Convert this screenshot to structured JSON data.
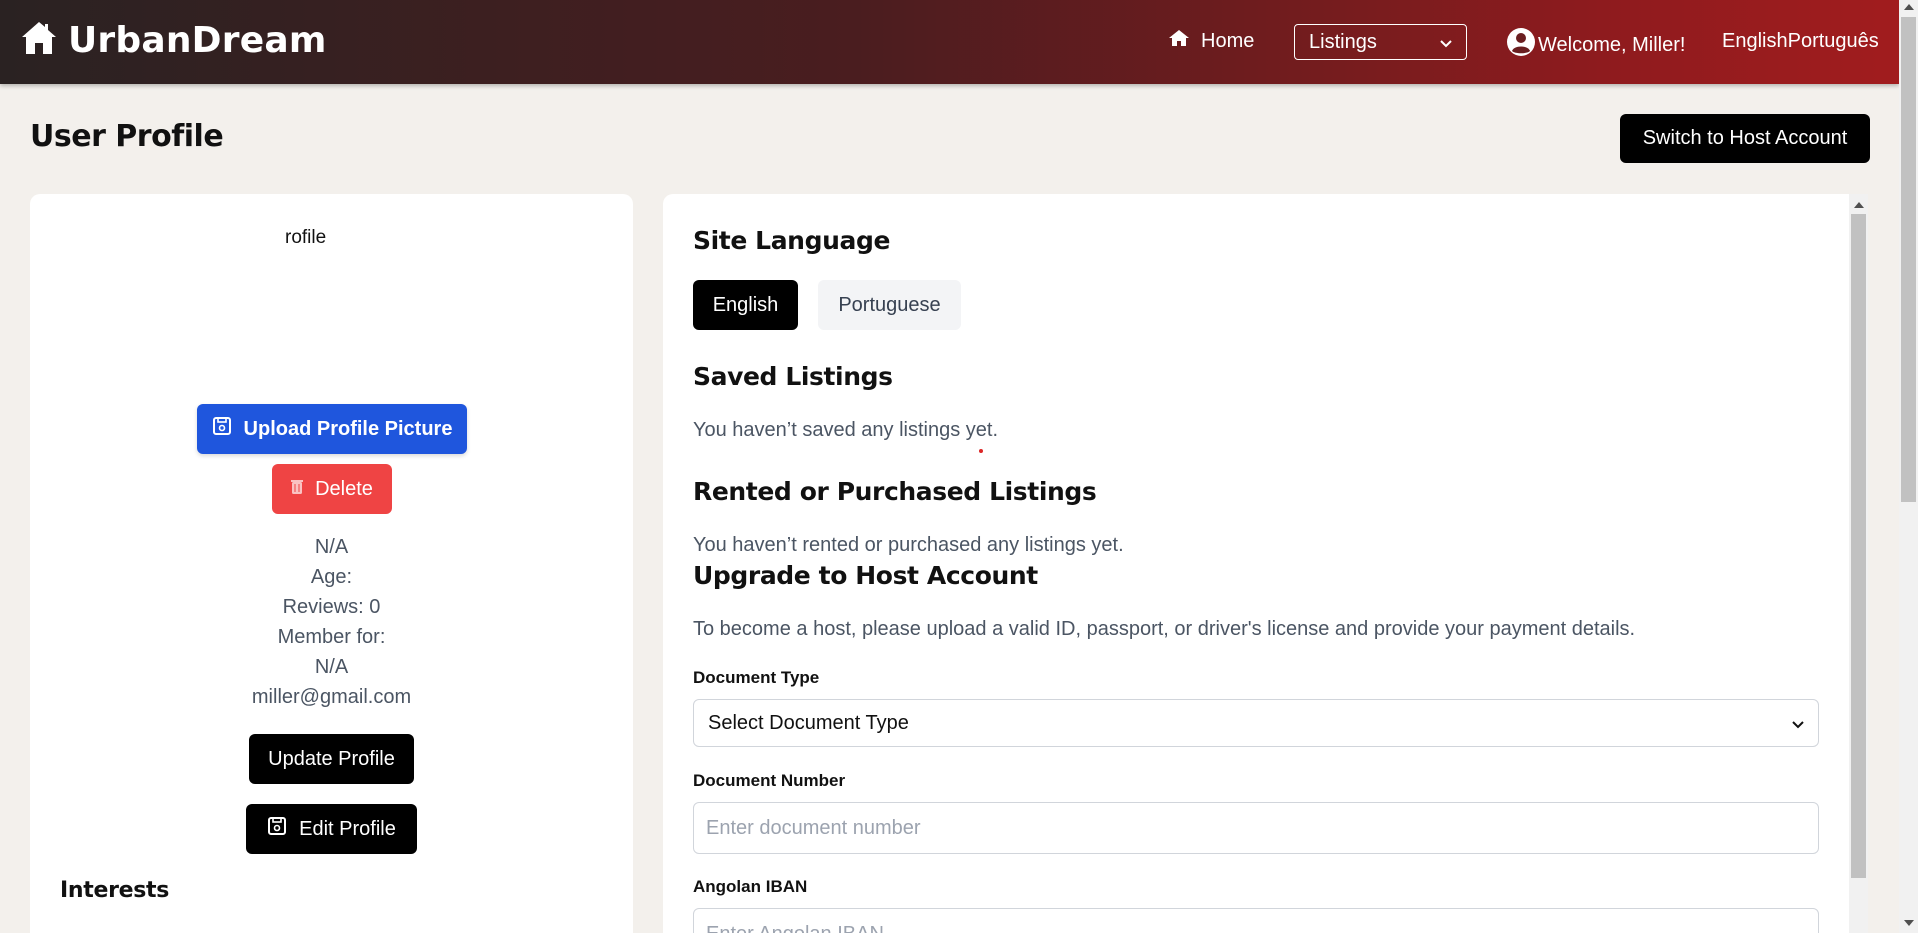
{
  "header": {
    "brand": "UrbanDream",
    "home_label": "Home",
    "listings_select": "Listings",
    "welcome": "Welcome, Miller!",
    "lang_en": "English",
    "lang_pt": "Português"
  },
  "page": {
    "title": "User Profile",
    "switch_host": "Switch to Host Account"
  },
  "profile": {
    "avatar_alt": "rofile",
    "upload_label": "Upload Profile Picture",
    "delete_label": "Delete",
    "name": "N/A",
    "age": "Age:",
    "reviews": "Reviews: 0",
    "member_for": "Member for:",
    "member_value": "N/A",
    "email": "miller@gmail.com",
    "update_label": "Update Profile",
    "edit_label": "Edit Profile",
    "interests_heading": "Interests"
  },
  "settings": {
    "site_language_heading": "Site Language",
    "lang_english": "English",
    "lang_portuguese": "Portuguese",
    "saved_heading": "Saved Listings",
    "saved_empty": "You haven’t saved any listings yet.",
    "rented_heading": "Rented or Purchased Listings",
    "rented_empty": "You haven’t rented or purchased any listings yet.",
    "upgrade_heading": "Upgrade to Host Account",
    "upgrade_desc": "To become a host, please upload a valid ID, passport, or driver's license and provide your payment details.",
    "doc_type_label": "Document Type",
    "doc_type_value": "Select Document Type",
    "doc_number_label": "Document Number",
    "doc_number_placeholder": "Enter document number",
    "iban_label": "Angolan IBAN",
    "iban_placeholder": "Enter Angolan IBAN"
  },
  "colors": {
    "header_start": "#2a2222",
    "header_end": "#a11c1e",
    "upload_blue": "#1f56dd",
    "delete_red": "#ef4444",
    "page_bg": "#f3f0ec"
  }
}
